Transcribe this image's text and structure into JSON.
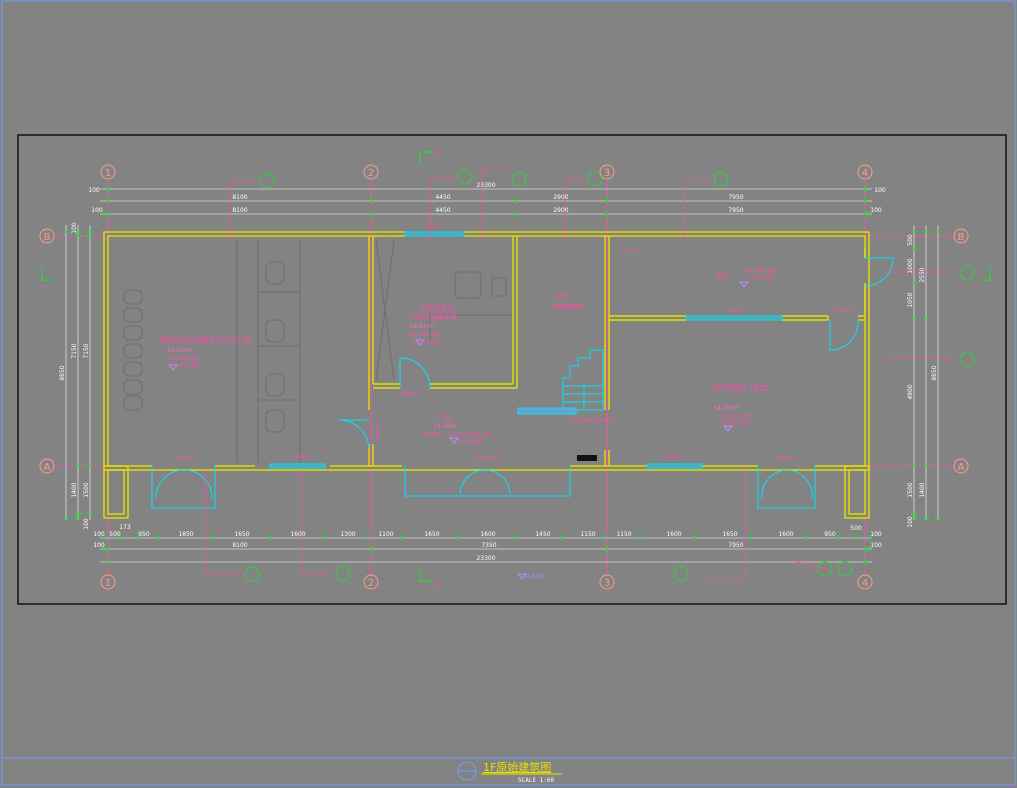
{
  "grid_axes": {
    "horizontal": [
      "1",
      "2",
      "3",
      "4"
    ],
    "vertical": [
      "B",
      "A"
    ]
  },
  "section_marker": "2",
  "side_marker": "1",
  "dimensions": {
    "top_total": "23300",
    "top_row1": [
      "100",
      "100"
    ],
    "top_row2": [
      "8100",
      "4450",
      "2900",
      "7950"
    ],
    "top_row3": [
      "100",
      "8100",
      "4450",
      "2900",
      "7950",
      "100"
    ],
    "bottom_row1": [
      "100",
      "500",
      "950",
      "1850",
      "1650",
      "1600",
      "1300",
      "1100",
      "1650",
      "1600",
      "1450",
      "1150",
      "1150",
      "1600",
      "1650",
      "1600",
      "950",
      "500",
      "100"
    ],
    "bottom_row2": [
      "100",
      "8100",
      "7350",
      "7950",
      "100"
    ],
    "bottom_total": "23300",
    "bottom_extra": "173",
    "left_total": "8650",
    "left_upper": [
      "100",
      "7150"
    ],
    "left_upper_inner": "7150",
    "left_lower": [
      "1400",
      "1500"
    ],
    "left_bottom": "100",
    "right_total": "8650",
    "right_upper": [
      "500",
      "1000",
      "2550",
      "1050"
    ],
    "right_lower": [
      "4900",
      "1500",
      "1400",
      "100"
    ]
  },
  "rooms": {
    "office": {
      "name": "便民利民综合服务大厅办公室",
      "area": "54.01m²",
      "level1": "±0.000 (粉)",
      "level2": "-0.050 (粉)"
    },
    "toilet": {
      "name1": "卫生服务站",
      "name2": "计划生育服务室",
      "area": "18.91m²",
      "level1": "±0.000 (粉)",
      "level2": "-0.050 (粉)"
    },
    "lobby": {
      "name": "门厅",
      "area": "15.45m²",
      "level1": "±0.000~-1.300,0.050 (粉)",
      "level2": "-0.050 (粉)"
    },
    "stair": {
      "name": "LT1",
      "sub": "无障碍楼梯",
      "note": "(3=2900-1300)"
    },
    "storage": {
      "name": "食堂",
      "level1": "±0.000 (粉)",
      "level2": "-0.050 (粉)"
    },
    "canteen": {
      "name": "农村幸福院（食堂）",
      "area": "34.10m²",
      "level1": "±0.000 (粉)",
      "level2": "-0.050 (粉)"
    }
  },
  "opening_tags": {
    "top_window": "C4102",
    "c2011": "C2011",
    "m1021": "M1021",
    "m1021b": "M1021",
    "mc1": "M1523",
    "c2021": "C2021",
    "mc2": "MLC3130",
    "c2021b": "C2021",
    "m1523b": "M1523",
    "fm": "FM1021"
  },
  "elevation": "-0.100",
  "title": "1F原始建筑图",
  "scale": "SCALE 1:60",
  "colors": {
    "wall": "#e5e000",
    "grid": "#ff4da6",
    "axis_bubble": "#ff9a8a",
    "dim": "#ffffff",
    "dim_mark": "#27d83a",
    "window": "#00e5ff",
    "tag": "#ff4da6",
    "border": "#111111"
  }
}
